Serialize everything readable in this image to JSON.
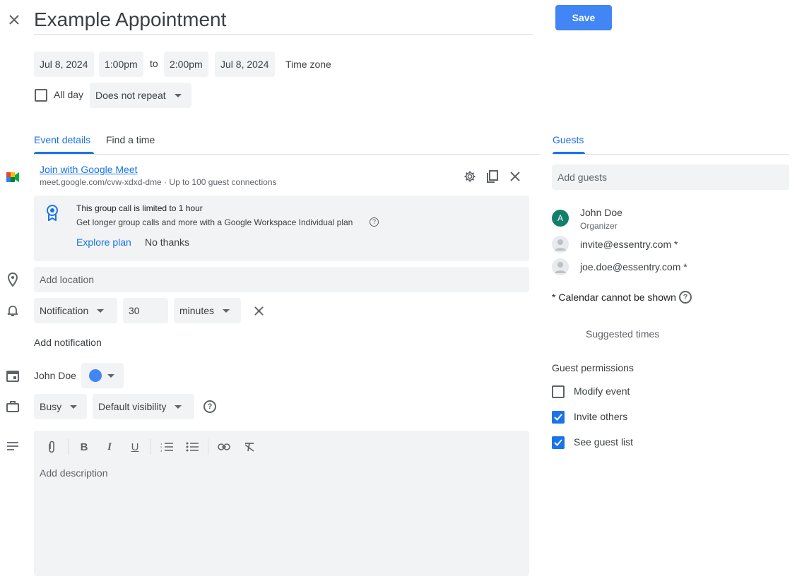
{
  "header": {
    "title": "Example Appointment",
    "save_label": "Save"
  },
  "datetime": {
    "start_date": "Jul 8, 2024",
    "start_time": "1:00pm",
    "to_label": "to",
    "end_time": "2:00pm",
    "end_date": "Jul 8, 2024",
    "timezone_label": "Time zone",
    "allday_label": "All day",
    "repeat": "Does not repeat"
  },
  "tabs": {
    "event_details": "Event details",
    "find_time": "Find a time",
    "guests": "Guests"
  },
  "meet": {
    "join_label": "Join with Google Meet",
    "link_info": "meet.google.com/cvw-xdxd-dme · Up to 100 guest connections",
    "notice_title": "This group call is limited to 1 hour",
    "notice_body": "Get longer group calls and more with a Google Workspace Individual plan",
    "explore_label": "Explore plan",
    "no_thanks_label": "No thanks"
  },
  "location": {
    "placeholder": "Add location"
  },
  "notification": {
    "type": "Notification",
    "value": "30",
    "unit": "minutes",
    "add_label": "Add notification"
  },
  "calendar": {
    "owner": "John Doe",
    "color": "#4285f4"
  },
  "availability": {
    "status": "Busy",
    "visibility": "Default visibility"
  },
  "description": {
    "placeholder": "Add description"
  },
  "guests": {
    "add_placeholder": "Add guests",
    "list": [
      {
        "name": "John Doe",
        "role": "Organizer",
        "avatar_letter": "A",
        "avatar_color": "#137f6b"
      },
      {
        "name": "invite@essentry.com *"
      },
      {
        "name": "joe.doe@essentry.com *"
      }
    ],
    "calendar_note": "* Calendar cannot be shown",
    "suggested_times": "Suggested times",
    "permissions_title": "Guest permissions",
    "permissions": [
      {
        "label": "Modify event",
        "checked": false
      },
      {
        "label": "Invite others",
        "checked": true
      },
      {
        "label": "See guest list",
        "checked": true
      }
    ]
  },
  "colors": {
    "accent": "#1a73e8",
    "save_button": "#4285f4",
    "field_bg": "#f1f3f4"
  }
}
